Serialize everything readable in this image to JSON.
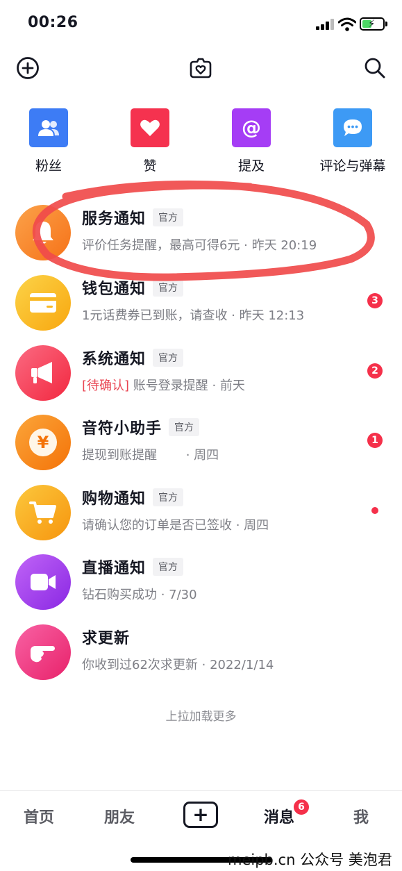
{
  "status_bar": {
    "time": "00:26"
  },
  "categories": [
    {
      "label": "粉丝",
      "icon": "fans-icon",
      "color": "#3d7cf5"
    },
    {
      "label": "赞",
      "icon": "heart-icon",
      "color": "#f5324f"
    },
    {
      "label": "提及",
      "icon": "at-icon",
      "color": "#a53df5"
    },
    {
      "label": "评论与弹幕",
      "icon": "comment-icon",
      "color": "#3d9af5"
    }
  ],
  "notifications": [
    {
      "title": "服务通知",
      "tag": "官方",
      "subtitle": "评价任务提醒，最高可得6元 · 昨天 20:19",
      "icon": "bell-icon",
      "color": "#f9812a"
    },
    {
      "title": "钱包通知",
      "tag": "官方",
      "subtitle": "1元话费券已到账，请查收 · 昨天 12:13",
      "icon": "card-icon",
      "color": "#f9b824",
      "badge": "3"
    },
    {
      "title": "系统通知",
      "tag": "官方",
      "subtitle_tag": "[待确认]",
      "subtitle": " 账号登录提醒 · 前天",
      "icon": "megaphone-icon",
      "color": "#f53b5c",
      "badge": "2"
    },
    {
      "title": "音符小助手",
      "tag": "官方",
      "subtitle": "提现到账提醒 　　· 周四",
      "icon": "yuan-icon",
      "color": "#f98a16",
      "badge": "1"
    },
    {
      "title": "购物通知",
      "tag": "官方",
      "subtitle": "请确认您的订单是否已签收 · 周四",
      "icon": "cart-icon",
      "color": "#f9a71e",
      "dot": true
    },
    {
      "title": "直播通知",
      "tag": "官方",
      "subtitle": "钻石购买成功 · 7/30",
      "icon": "video-camera-icon",
      "color": "#a33df0"
    },
    {
      "title": "求更新",
      "subtitle": "你收到过62次求更新 · 2022/1/14",
      "icon": "pointing-hand-icon",
      "color": "#f0397b"
    }
  ],
  "load_more": "上拉加载更多",
  "tabbar": {
    "home": "首页",
    "friends": "朋友",
    "plus": "+",
    "messages": "消息",
    "messages_badge": "6",
    "me": "我"
  },
  "watermark": "meipb.cn 公众号 美泡君",
  "colors": {
    "annotation": "#f04b4b",
    "badge": "#f5304a"
  }
}
